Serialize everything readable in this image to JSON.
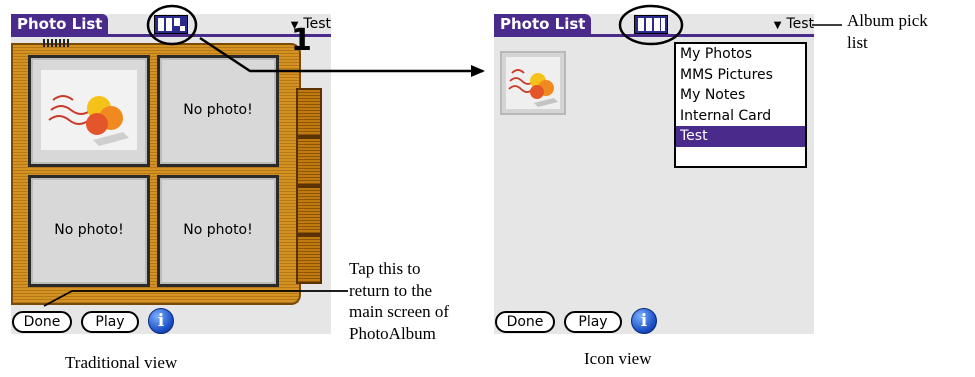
{
  "left_screen": {
    "title": "Photo List",
    "album_selected": "Test",
    "slots": [
      {
        "label": ""
      },
      {
        "label": "No photo!"
      },
      {
        "label": "No photo!"
      },
      {
        "label": "No photo!"
      }
    ],
    "page_number": "1",
    "buttons": {
      "done": "Done",
      "play": "Play",
      "info": "i"
    }
  },
  "right_screen": {
    "title": "Photo List",
    "album_selected": "Test",
    "album_menu": [
      "My Photos",
      "MMS Pictures",
      "My Notes",
      "Internal Card",
      "Test"
    ],
    "album_menu_selected_index": 4,
    "buttons": {
      "done": "Done",
      "play": "Play",
      "info": "i"
    }
  },
  "captions": {
    "left": "Traditional view",
    "right": "Icon view"
  },
  "annotations": {
    "album_pick_line1": "Album pick",
    "album_pick_line2": "list",
    "tap_lines": [
      "Tap this to",
      "return to the",
      "main screen of",
      "PhotoAlbum"
    ]
  }
}
